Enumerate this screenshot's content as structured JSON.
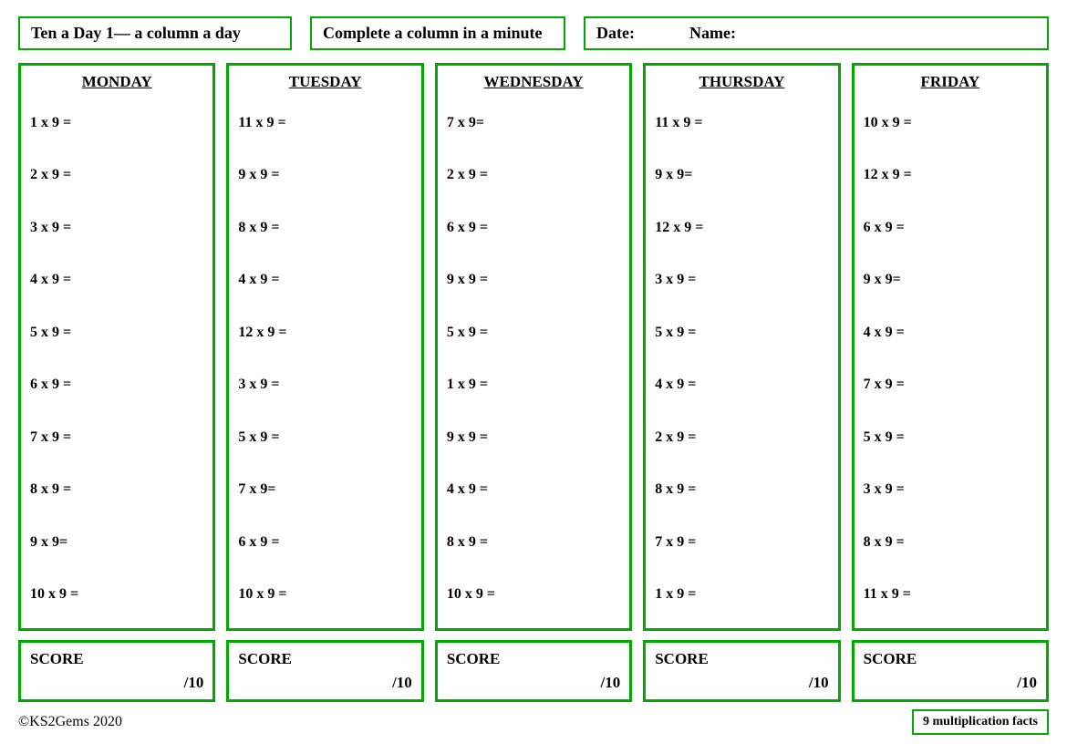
{
  "header": {
    "title": "Ten a Day 1— a column a day",
    "subtitle": "Complete a column in a minute",
    "date_label": "Date:",
    "name_label": "Name:"
  },
  "days": [
    {
      "name": "MONDAY",
      "problems": [
        "1 x 9 =",
        "2 x 9 =",
        "3 x 9 =",
        "4 x 9 =",
        "5 x 9 =",
        "6 x 9 =",
        "7 x 9 =",
        "8 x 9 =",
        "9 x 9=",
        "10 x 9 ="
      ],
      "score_label": "SCORE",
      "score_value": "/10"
    },
    {
      "name": "TUESDAY",
      "problems": [
        "11 x 9 =",
        "9 x 9 =",
        "8 x 9 =",
        "4 x 9 =",
        "12 x 9 =",
        "3 x 9 =",
        "5 x 9 =",
        "7 x 9=",
        "6 x 9 =",
        "10 x 9 ="
      ],
      "score_label": "SCORE",
      "score_value": "/10"
    },
    {
      "name": "WEDNESDAY",
      "problems": [
        "7 x 9=",
        "2 x 9 =",
        "6 x 9 =",
        "9 x 9 =",
        "5 x 9 =",
        "1 x 9 =",
        "9 x 9 =",
        "4 x 9 =",
        "8 x 9 =",
        "10 x 9 ="
      ],
      "score_label": "SCORE",
      "score_value": "/10"
    },
    {
      "name": "THURSDAY",
      "problems": [
        "11 x 9 =",
        "9 x 9=",
        "12 x 9 =",
        "3 x 9 =",
        "5 x 9 =",
        "4 x 9 =",
        "2 x 9 =",
        "8 x 9 =",
        "7 x 9 =",
        "1 x 9 ="
      ],
      "score_label": "SCORE",
      "score_value": "/10"
    },
    {
      "name": "FRIDAY",
      "problems": [
        "10 x 9 =",
        "12 x 9 =",
        "6 x 9 =",
        "9 x 9=",
        "4 x 9 =",
        "7 x 9 =",
        "5 x 9 =",
        "3 x 9 =",
        "8 x 9 =",
        "11 x 9 ="
      ],
      "score_label": "SCORE",
      "score_value": "/10"
    }
  ],
  "footer": {
    "copyright": "©KS2Gems 2020",
    "facts_badge": "9 multiplication facts"
  }
}
